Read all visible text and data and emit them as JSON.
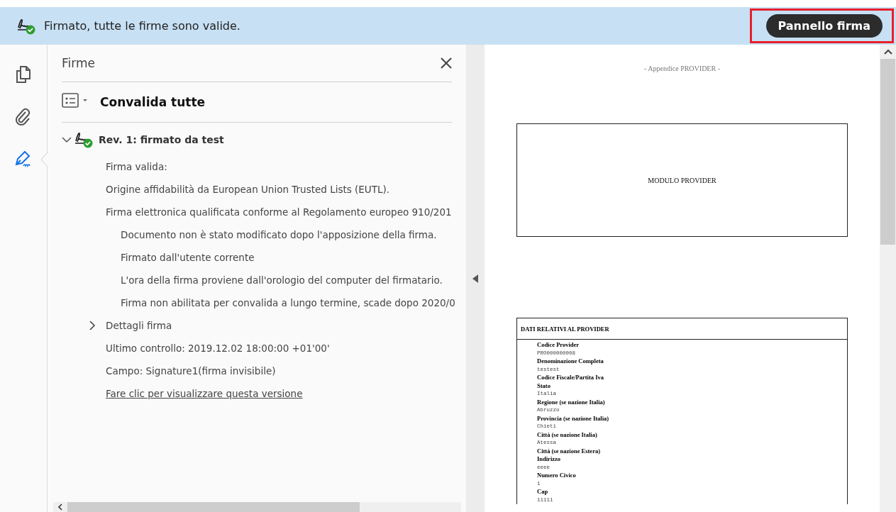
{
  "banner": {
    "message": "Firmato, tutte le firme sono valide.",
    "button": "Pannello firma",
    "highlighted": true
  },
  "tools": [
    {
      "kind": "pages",
      "selected": false
    },
    {
      "kind": "attachment",
      "selected": false
    },
    {
      "kind": "signature",
      "selected": true
    }
  ],
  "panel": {
    "title": "Firme",
    "validate_all": "Convalida tutte",
    "revision": {
      "label": "Rev. 1: firmato da test",
      "expanded": true,
      "children": [
        {
          "text": "Firma valida:"
        },
        {
          "text": "Origine affidabilità da European Union Trusted Lists (EUTL)."
        },
        {
          "text": "Firma elettronica qualificata conforme al Regolamento europeo 910/201",
          "children": [
            {
              "text": "Documento non è stato modificato dopo l'apposizione della firma."
            },
            {
              "text": "Firmato dall'utente corrente"
            },
            {
              "text": "L'ora della firma proviene dall'orologio del computer del firmatario."
            },
            {
              "text": "Firma non abilitata per convalida a lungo termine, scade dopo 2020/0"
            }
          ]
        },
        {
          "text": "Dettagli firma",
          "kind": "expander",
          "expanded": false
        },
        {
          "text": "Ultimo controllo: 2019.12.02 18:00:00 +01'00'"
        },
        {
          "text": "Campo: Signature1(firma invisibile)"
        },
        {
          "text": "Fare clic per visualizzare questa versione",
          "kind": "link"
        }
      ]
    }
  },
  "document": {
    "header": "- Appendice PROVIDER -",
    "form_title": "MODULO PROVIDER",
    "section_title": "DATI RELATIVI AL PROVIDER",
    "fields": [
      {
        "label": "Codice Provider",
        "value": "PRO000000008"
      },
      {
        "label": "Denominazione Completa",
        "value": "testest"
      },
      {
        "label": "Codice Fiscale/Partita Iva"
      },
      {
        "label": "Stato",
        "value": "Italia"
      },
      {
        "label": "Regione (se nazione Italia)",
        "value": "Abruzzo"
      },
      {
        "label": "Provincia (se nazione Italia)",
        "value": "Chieti"
      },
      {
        "label": "Città (se nazione Italia)",
        "value": "Atessa"
      },
      {
        "label": "Città (se nazione Estera)"
      },
      {
        "label": "Indirizzo",
        "value": "eeee"
      },
      {
        "label": "Numero Civico",
        "value": "1"
      },
      {
        "label": "Cap",
        "value": "11111"
      }
    ]
  }
}
